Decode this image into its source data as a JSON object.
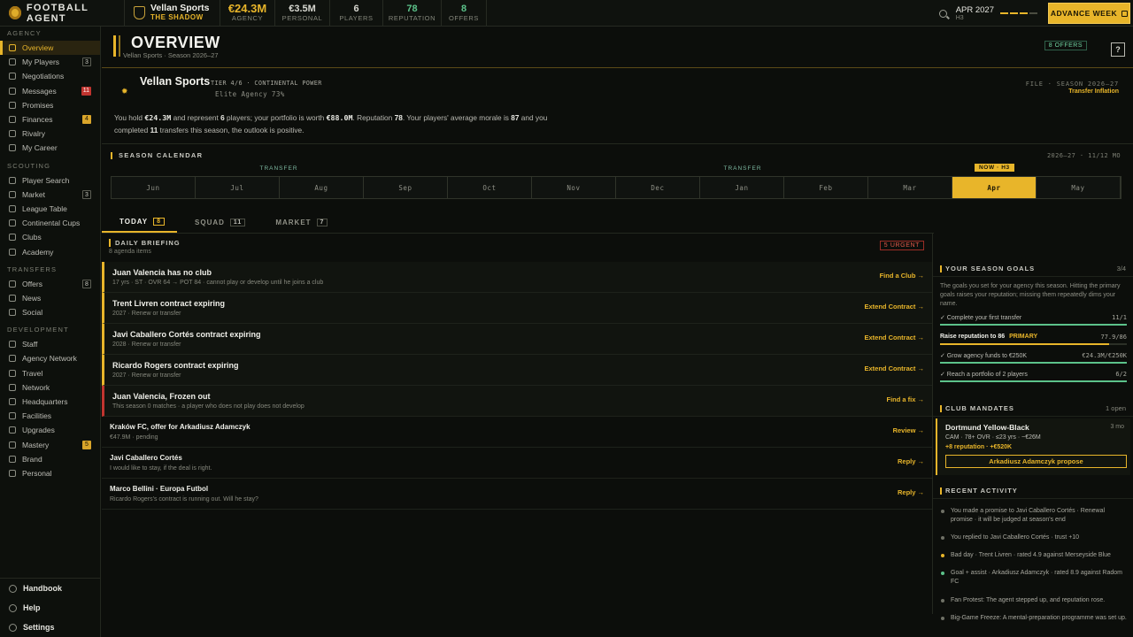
{
  "app": {
    "brand": "FOOTBALL AGENT"
  },
  "agency": {
    "name": "Vellan Sports",
    "tagline": "THE SHADOW"
  },
  "topstats": [
    {
      "value": "€24.3M",
      "label": "AGENCY"
    },
    {
      "value": "€3.5M",
      "label": "PERSONAL"
    },
    {
      "value": "6",
      "label": "PLAYERS"
    },
    {
      "value": "78",
      "label": "REPUTATION"
    },
    {
      "value": "8",
      "label": "OFFERS"
    }
  ],
  "date": {
    "month": "APR 2027",
    "half": "H3"
  },
  "advance_label": "ADVANCE WEEK",
  "sidebar": {
    "sections": [
      {
        "title": "AGENCY",
        "items": [
          {
            "label": "Overview",
            "badge": "",
            "icon": "grid-icon"
          },
          {
            "label": "My Players",
            "badge": "3",
            "icon": "user-icon"
          },
          {
            "label": "Negotiations",
            "badge": "",
            "icon": "handshake-icon"
          },
          {
            "label": "Messages",
            "badge": "11",
            "icon": "mail-icon"
          },
          {
            "label": "Promises",
            "badge": "",
            "icon": "promise-icon"
          },
          {
            "label": "Finances",
            "badge": "4",
            "icon": "money-icon"
          },
          {
            "label": "Rivalry",
            "badge": "",
            "icon": "swords-icon"
          },
          {
            "label": "My Career",
            "badge": "",
            "icon": "person-icon"
          }
        ]
      },
      {
        "title": "SCOUTING",
        "items": [
          {
            "label": "Player Search",
            "badge": "",
            "icon": "search-icon"
          },
          {
            "label": "Market",
            "badge": "3",
            "icon": "chart-icon"
          },
          {
            "label": "League Table",
            "badge": "",
            "icon": "table-icon"
          },
          {
            "label": "Continental Cups",
            "badge": "",
            "icon": "cup-icon"
          },
          {
            "label": "Clubs",
            "badge": "",
            "icon": "club-icon"
          },
          {
            "label": "Academy",
            "badge": "",
            "icon": "academy-icon"
          }
        ]
      },
      {
        "title": "TRANSFERS",
        "items": [
          {
            "label": "Offers",
            "badge": "8",
            "icon": "offer-icon"
          },
          {
            "label": "News",
            "badge": "",
            "icon": "news-icon"
          },
          {
            "label": "Social",
            "badge": "",
            "icon": "chat-icon"
          }
        ]
      },
      {
        "title": "DEVELOPMENT",
        "items": [
          {
            "label": "Staff",
            "badge": "",
            "icon": "staff-icon"
          },
          {
            "label": "Agency Network",
            "badge": "",
            "icon": "network-icon"
          },
          {
            "label": "Travel",
            "badge": "",
            "icon": "plane-icon"
          },
          {
            "label": "Network",
            "badge": "",
            "icon": "globe-icon"
          },
          {
            "label": "Headquarters",
            "badge": "",
            "icon": "building-icon"
          },
          {
            "label": "Facilities",
            "badge": "",
            "icon": "facility-icon"
          },
          {
            "label": "Upgrades",
            "badge": "",
            "icon": "upgrade-icon"
          },
          {
            "label": "Mastery",
            "badge": "5",
            "icon": "mastery-icon"
          },
          {
            "label": "Brand",
            "badge": "",
            "icon": "brand-icon"
          },
          {
            "label": "Personal",
            "badge": "",
            "icon": "diamond-icon"
          }
        ]
      }
    ],
    "bottom": [
      {
        "label": "Handbook",
        "icon": "book-icon"
      },
      {
        "label": "Help",
        "icon": "help-icon"
      },
      {
        "label": "Settings",
        "icon": "gear-icon"
      }
    ]
  },
  "page": {
    "title": "OVERVIEW",
    "subtitle": "Vellan Sports · Season 2026–27",
    "offers_chip": "8 OFFERS",
    "help": "?"
  },
  "agency_card": {
    "name": "Vellan Sports",
    "tier": "TIER 4/6 · CONTINENTAL POWER",
    "elite": "Elite Agency 73%",
    "file": "FILE · SEASON 2026–27",
    "file_sub": "Transfer Inflation",
    "summary": {
      "p1": "You hold ",
      "funds": "€24.3M",
      "p2": " and represent ",
      "players": "6",
      "p3": " players; your portfolio is worth ",
      "portfolio": "€88.0M",
      "p4": ". Reputation ",
      "rep": "78",
      "p5": ". Your players' average morale is ",
      "morale": "87",
      "p6": " and you completed ",
      "transfers": "11",
      "p7": " transfers this season, the outlook is positive."
    }
  },
  "calendar": {
    "title": "SEASON CALENDAR",
    "range": "2026–27 · 11/12 MO",
    "months": [
      "Jun",
      "Jul",
      "Aug",
      "Sep",
      "Oct",
      "Nov",
      "Dec",
      "Jan",
      "Feb",
      "Mar",
      "Apr",
      "May"
    ],
    "now_index": 10,
    "now_label": "NOW · H3",
    "transfer_label": "TRANSFER"
  },
  "tabs": [
    {
      "label": "TODAY",
      "count": "8"
    },
    {
      "label": "SQUAD",
      "count": "11"
    },
    {
      "label": "MARKET",
      "count": "7"
    }
  ],
  "briefing": {
    "title": "DAILY BRIEFING",
    "subtitle": "8 agenda items",
    "urgent": "5 URGENT",
    "items": [
      {
        "title": "Juan Valencia has no club",
        "sub": "17 yrs · ST · OVR 64 → POT 84 · cannot play or develop until he joins a club",
        "action": "Find a Club →",
        "level": "y"
      },
      {
        "title": "Trent Livren contract expiring",
        "sub": "2027 · Renew or transfer",
        "action": "Extend Contract →",
        "level": "y"
      },
      {
        "title": "Javi Caballero Cortés contract expiring",
        "sub": "2028 · Renew or transfer",
        "action": "Extend Contract →",
        "level": "y"
      },
      {
        "title": "Ricardo Rogers contract expiring",
        "sub": "2027 · Renew or transfer",
        "action": "Extend Contract →",
        "level": "y"
      },
      {
        "title": "Juan Valencia, Frozen out",
        "sub": "This season 0 matches · a player who does not play does not develop",
        "action": "Find a fix →",
        "level": "r"
      },
      {
        "title": "Kraków FC, offer for Arkadiusz Adamczyk",
        "sub": "€47.9M · pending",
        "action": "Review →",
        "level": ""
      },
      {
        "title": "Javi Caballero Cortés",
        "sub": "I would like to stay, if the deal is right.",
        "action": "Reply →",
        "level": ""
      },
      {
        "title": "Marco Bellini · Europa Futbol",
        "sub": "Ricardo Rogers's contract is running out. Will he stay?",
        "action": "Reply →",
        "level": ""
      }
    ]
  },
  "goals": {
    "title": "YOUR SEASON GOALS",
    "count": "3/4",
    "desc": "The goals you set for your agency this season. Hitting the primary goals raises your reputation; missing them repeatedly dims your name.",
    "items": [
      {
        "label": "✓ Complete your first transfer",
        "value": "11/1",
        "progress": 1.0,
        "primary": false
      },
      {
        "label": "Raise reputation to 86",
        "tag": "PRIMARY",
        "value": "77.9/86",
        "progress": 0.906,
        "primary": true
      },
      {
        "label": "✓ Grow agency funds to €250K",
        "value": "€24.3M/€250K",
        "progress": 1.0,
        "primary": false
      },
      {
        "label": "✓ Reach a portfolio of 2 players",
        "value": "6/2",
        "progress": 1.0,
        "primary": false
      }
    ]
  },
  "mandates": {
    "title": "CLUB MANDATES",
    "count": "1 open",
    "club": "Dortmund Yellow-Black",
    "duration": "3 mo",
    "spec": "CAM · 78+ OVR · ≤23 yrs · ~€26M",
    "reward": "+8 reputation · +€520K",
    "button": "Arkadiusz Adamczyk propose"
  },
  "activity": {
    "title": "RECENT ACTIVITY",
    "items": [
      {
        "text": "You made a promise to Javi Caballero Cortés · Renewal promise · it will be judged at season's end",
        "tone": ""
      },
      {
        "text": "You replied to Javi Caballero Cortés · trust +10",
        "tone": ""
      },
      {
        "text": "Bad day · Trent Livren · rated 4.9 against Merseyside Blue",
        "tone": "y"
      },
      {
        "text": "Goal + assist · Arkadiusz Adamczyk · rated 8.9 against Radom FC",
        "tone": "g"
      },
      {
        "text": "Fan Protest: The agent stepped up, and reputation rose.",
        "tone": ""
      },
      {
        "text": "Big-Game Freeze: A mental-preparation programme was set up.",
        "tone": ""
      }
    ]
  }
}
